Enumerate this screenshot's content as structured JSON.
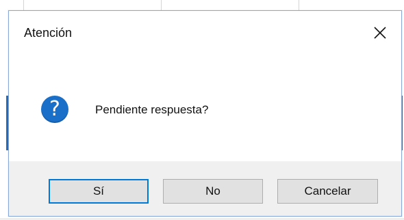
{
  "dialog": {
    "title": "Atención",
    "close_icon": "close-icon",
    "message": "Pendiente respuesta?",
    "message_icon": "question-icon",
    "question_glyph": "?",
    "buttons": {
      "yes_label": "Sí",
      "no_label": "No",
      "cancel_label": "Cancelar"
    }
  },
  "colors": {
    "accent": "#0078d7",
    "icon_blue": "#1a6fc8",
    "footer_bg": "#f0f0f0"
  }
}
